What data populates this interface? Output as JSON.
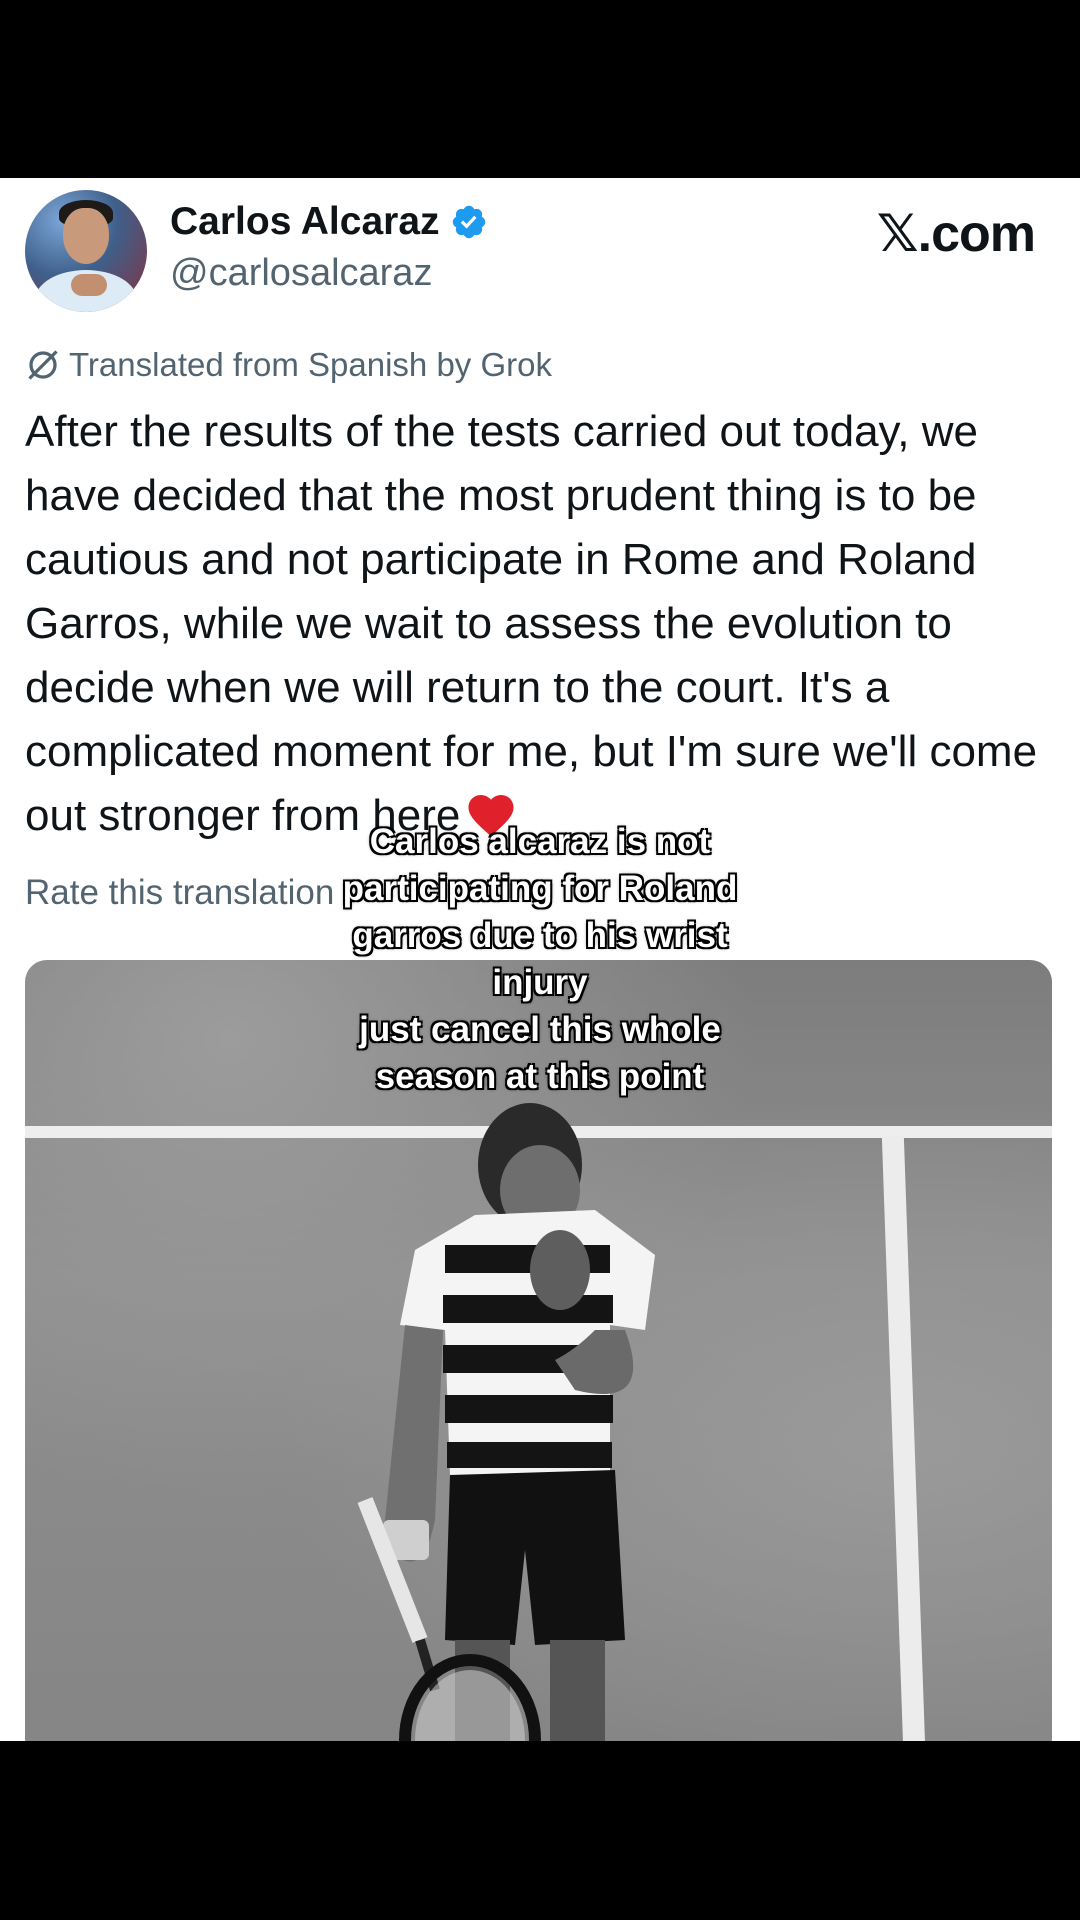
{
  "post": {
    "display_name": "Carlos Alcaraz",
    "handle": "@carlosalcaraz",
    "site": "𝕏.com",
    "translated_note": "Translated from Spanish by Grok",
    "text": "After the results of the tests carried out today, we have decided that the most prudent thing is to be cautious and not participate in Rome and Roland Garros, while we wait to assess the evolution to decide when we will return to the court. It's a complicated moment for me, but I'm sure we'll come out stronger from here",
    "rate_label": "Rate this translation"
  },
  "overlay": {
    "caption": "Carlos alcaraz is not\nparticipating for Roland\ngarros due to his wrist\ninjury\njust cancel this whole\nseason at this point"
  },
  "icons": {
    "verified": "verified-badge-icon",
    "grok": "grok-icon",
    "heart": "red-heart-icon"
  },
  "colors": {
    "verified_blue": "#1d9bf0",
    "heart_red": "#e0202a",
    "secondary_text": "#536471"
  }
}
